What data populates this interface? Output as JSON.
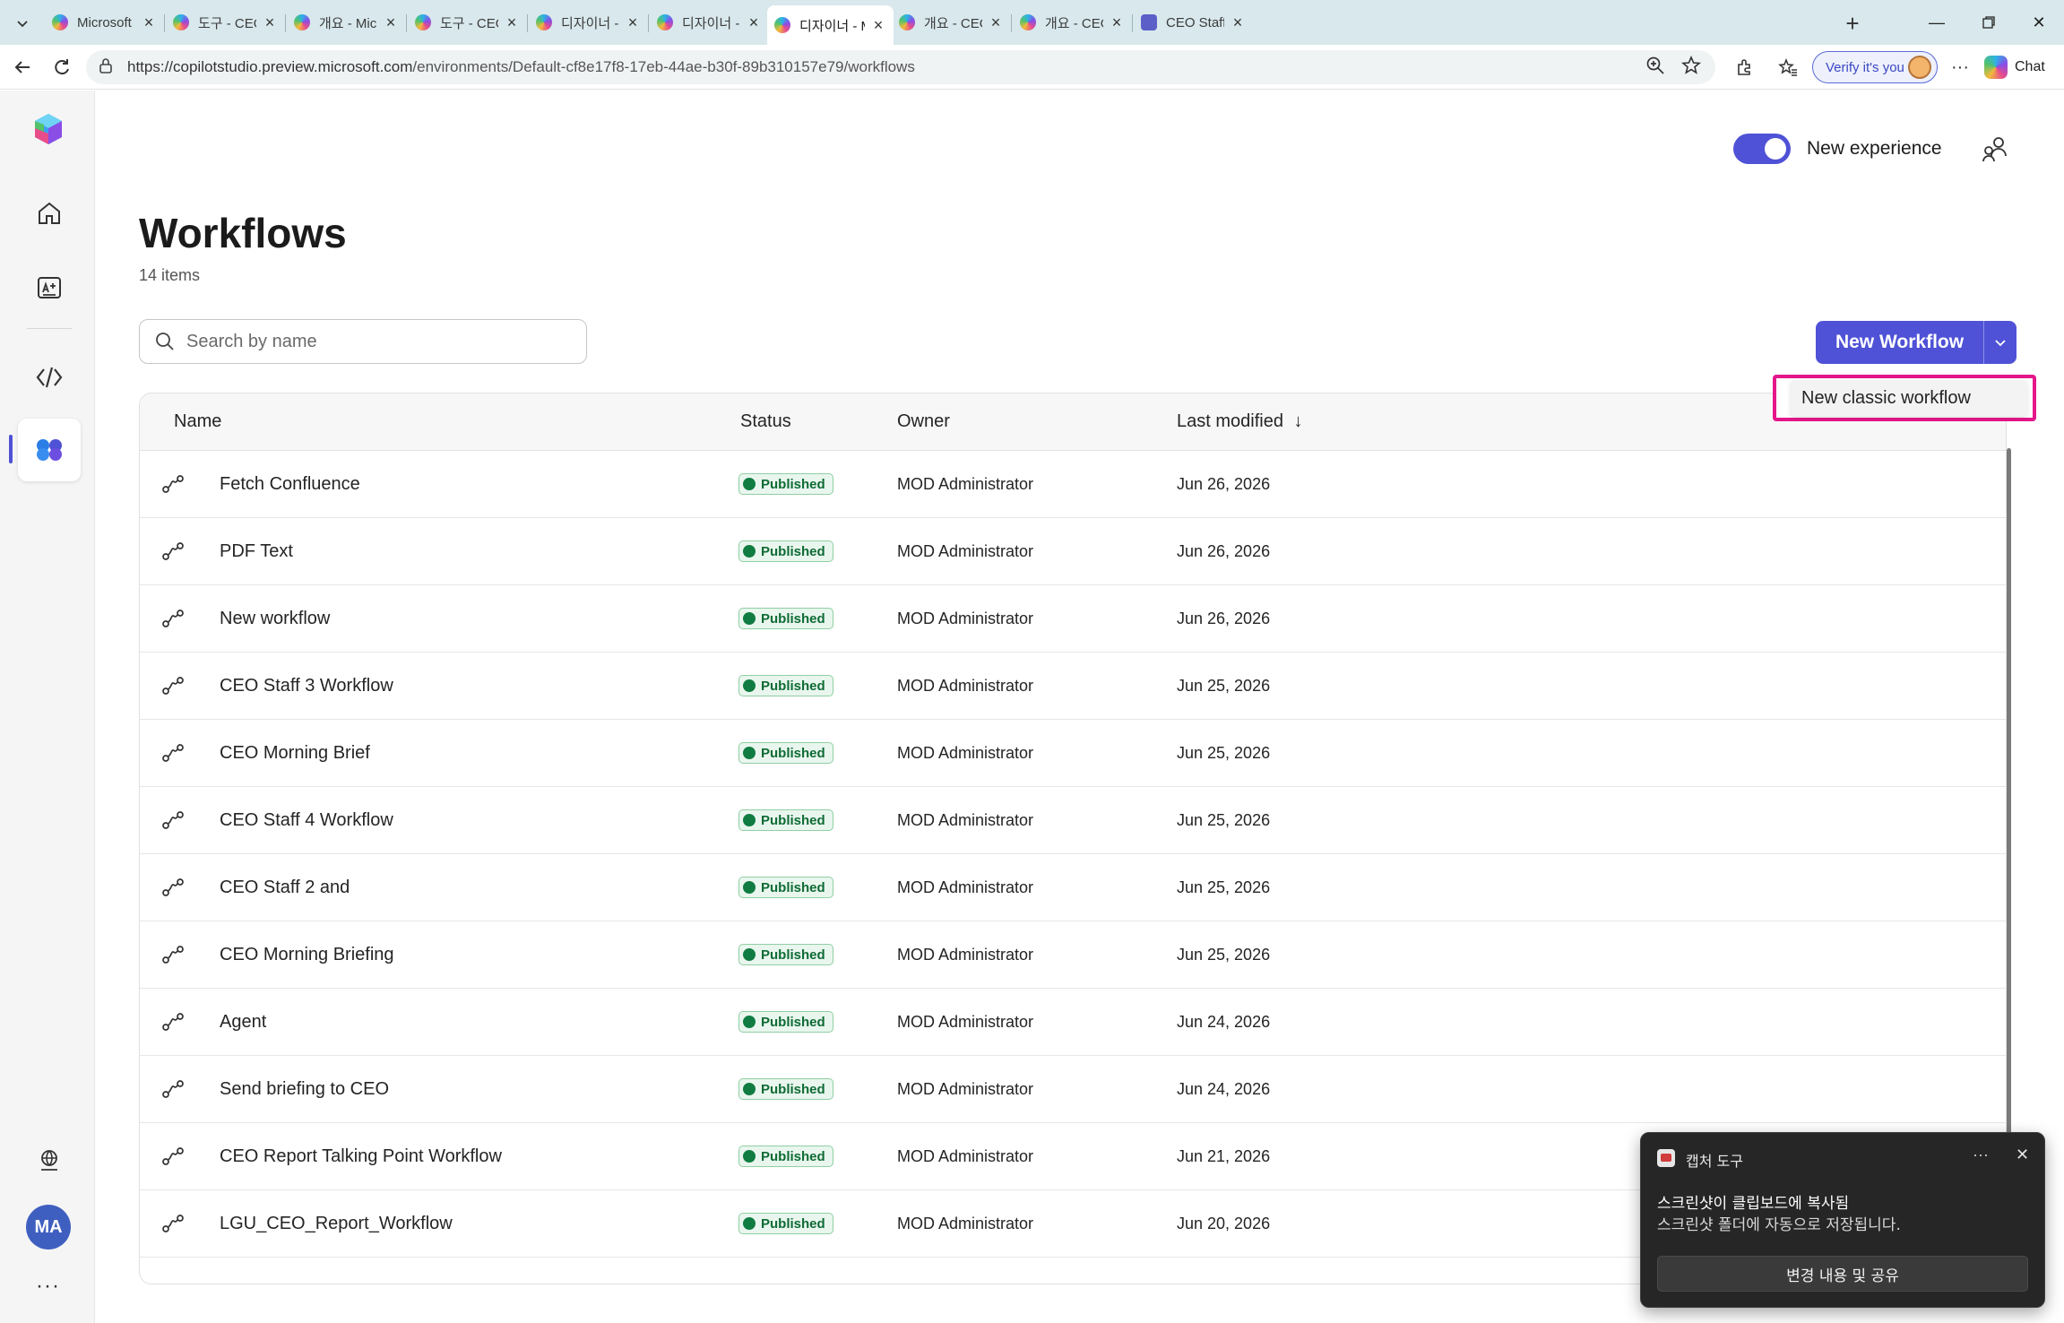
{
  "browser": {
    "tabs": [
      {
        "title": "Microsoft Copilot S",
        "active": false
      },
      {
        "title": "도구 - CEO Staff | M",
        "active": false
      },
      {
        "title": "개요 - Microsoft Co",
        "active": false
      },
      {
        "title": "도구 - CEO Staff | M",
        "active": false
      },
      {
        "title": "디자이너 - Microso",
        "active": false
      },
      {
        "title": "디자이너 - Microso",
        "active": false
      },
      {
        "title": "디자이너 - Microso",
        "active": true
      },
      {
        "title": "개요 - CEO Staff Ge",
        "active": false
      },
      {
        "title": "개요 - CEO Staff | M",
        "active": false
      },
      {
        "title": "CEO Staff | Microso",
        "active": false
      }
    ],
    "url_host": "https://copilotstudio.preview.microsoft.com",
    "url_path": "/environments/Default-cf8e17f8-17eb-44ae-b30f-89b310157e79/workflows",
    "verify_label": "Verify it's you",
    "chat_label": "Chat"
  },
  "rail": {
    "avatar_initials": "MA",
    "more": "···"
  },
  "header": {
    "experience_label": "New experience",
    "experience_on": true
  },
  "page": {
    "title": "Workflows",
    "count": "14 items",
    "search_placeholder": "Search by name",
    "new_workflow_label": "New Workflow",
    "dropdown_item": "New classic workflow"
  },
  "table": {
    "columns": {
      "name": "Name",
      "status": "Status",
      "owner": "Owner",
      "modified": "Last modified",
      "sort_arrow": "↓"
    },
    "rows": [
      {
        "name": "Fetch Confluence",
        "status": "Published",
        "owner": "MOD Administrator",
        "modified": "Jun 26, 2026"
      },
      {
        "name": "PDF Text",
        "status": "Published",
        "owner": "MOD Administrator",
        "modified": "Jun 26, 2026"
      },
      {
        "name": "New workflow",
        "status": "Published",
        "owner": "MOD Administrator",
        "modified": "Jun 26, 2026"
      },
      {
        "name": "CEO Staff 3 Workflow",
        "status": "Published",
        "owner": "MOD Administrator",
        "modified": "Jun 25, 2026"
      },
      {
        "name": "CEO Morning Brief",
        "status": "Published",
        "owner": "MOD Administrator",
        "modified": "Jun 25, 2026"
      },
      {
        "name": "CEO Staff 4 Workflow",
        "status": "Published",
        "owner": "MOD Administrator",
        "modified": "Jun 25, 2026"
      },
      {
        "name": "CEO Staff 2 and",
        "status": "Published",
        "owner": "MOD Administrator",
        "modified": "Jun 25, 2026"
      },
      {
        "name": "CEO Morning Briefing",
        "status": "Published",
        "owner": "MOD Administrator",
        "modified": "Jun 25, 2026"
      },
      {
        "name": "Agent",
        "status": "Published",
        "owner": "MOD Administrator",
        "modified": "Jun 24, 2026"
      },
      {
        "name": "Send briefing to CEO",
        "status": "Published",
        "owner": "MOD Administrator",
        "modified": "Jun 24, 2026"
      },
      {
        "name": "CEO Report Talking Point Workflow",
        "status": "Published",
        "owner": "MOD Administrator",
        "modified": "Jun 21, 2026"
      },
      {
        "name": "LGU_CEO_Report_Workflow",
        "status": "Published",
        "owner": "MOD Administrator",
        "modified": "Jun 20, 2026"
      }
    ]
  },
  "toast": {
    "app": "캡처 도구",
    "line1": "스크린샷이 클립보드에 복사됨",
    "line2": "스크린샷 폴더에 자동으로 저장됩니다.",
    "button": "변경 내용 및 공유",
    "more": "···",
    "close": "✕"
  },
  "colors": {
    "accent": "#4f52d6",
    "highlight": "#e5168a",
    "published": "#107c41"
  }
}
